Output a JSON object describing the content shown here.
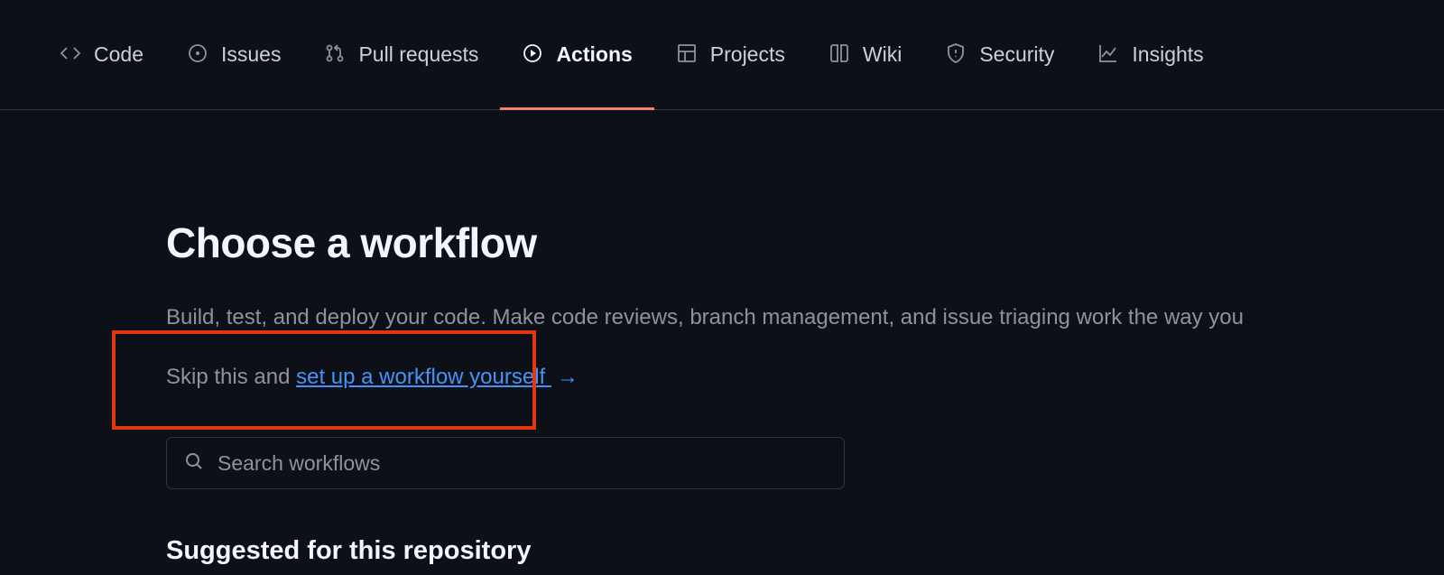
{
  "nav": {
    "items": [
      {
        "label": "Code"
      },
      {
        "label": "Issues"
      },
      {
        "label": "Pull requests"
      },
      {
        "label": "Actions"
      },
      {
        "label": "Projects"
      },
      {
        "label": "Wiki"
      },
      {
        "label": "Security"
      },
      {
        "label": "Insights"
      }
    ]
  },
  "main": {
    "title": "Choose a workflow",
    "description": "Build, test, and deploy your code. Make code reviews, branch management, and issue triaging work the way you",
    "skip_prefix": "Skip this and ",
    "skip_link": "set up a workflow yourself ",
    "search_placeholder": "Search workflows",
    "suggested_heading": "Suggested for this repository"
  },
  "colors": {
    "accent_link": "#4493f8",
    "highlight_border": "#e4370b",
    "tab_underline": "#f78166"
  }
}
